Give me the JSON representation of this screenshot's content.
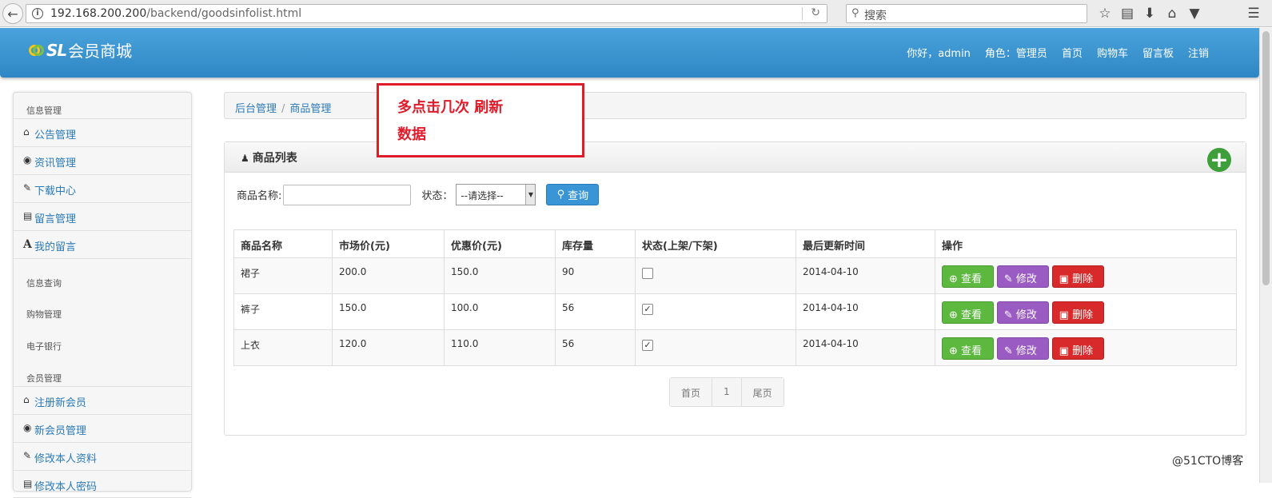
{
  "browser": {
    "url_host": "192.168.200.200",
    "url_path": "/backend/goodsinfolist.html",
    "search_placeholder": "搜索"
  },
  "header": {
    "logo_sl": "SL",
    "logo_name": "会员商城",
    "nav": {
      "greeting": "你好，admin",
      "role": "角色：管理员",
      "home": "首页",
      "cart": "购物车",
      "board": "留言板",
      "logout": "注销"
    }
  },
  "sidebar": {
    "section_info": "信息管理",
    "info_items": [
      "公告管理",
      "资讯管理",
      "下载中心",
      "留言管理",
      "我的留言"
    ],
    "section_query": "信息查询",
    "section_shopping": "购物管理",
    "section_bank": "电子银行",
    "section_member": "会员管理",
    "member_items": [
      "注册新会员",
      "新会员管理",
      "修改本人资料",
      "修改本人密码"
    ]
  },
  "breadcrumb": {
    "root": "后台管理",
    "sep": "/",
    "current": "商品管理"
  },
  "annotation": {
    "line1": "多点击几次 刷新",
    "line2": "数据"
  },
  "panel": {
    "title": "商品列表",
    "filter": {
      "name_label": "商品名称:",
      "status_label": "状态：",
      "status_selected": "--请选择--",
      "query_label": "查询"
    },
    "table": {
      "headers": [
        "商品名称",
        "市场价(元)",
        "优惠价(元)",
        "库存量",
        "状态(上架/下架)",
        "最后更新时间",
        "操作"
      ],
      "rows": [
        {
          "name": "裙子",
          "market": "200.0",
          "discount": "150.0",
          "stock": "90",
          "on_shelf": false,
          "updated": "2014-04-10"
        },
        {
          "name": "裤子",
          "market": "150.0",
          "discount": "100.0",
          "stock": "56",
          "on_shelf": true,
          "updated": "2014-04-10"
        },
        {
          "name": "上衣",
          "market": "120.0",
          "discount": "110.0",
          "stock": "56",
          "on_shelf": true,
          "updated": "2014-04-10"
        }
      ],
      "actions": {
        "view": "查看",
        "edit": "修改",
        "delete": "删除"
      }
    },
    "pager": {
      "first": "首页",
      "page": "1",
      "last": "尾页"
    }
  },
  "watermark": "@51CTO博客",
  "colors": {
    "header_blue": "#2f86c4",
    "link_blue": "#2a7ab8",
    "annotation_red": "#e01b2a",
    "view_green": "#5cb83f",
    "edit_purple": "#9a5bc3",
    "delete_red": "#d82a2a"
  }
}
